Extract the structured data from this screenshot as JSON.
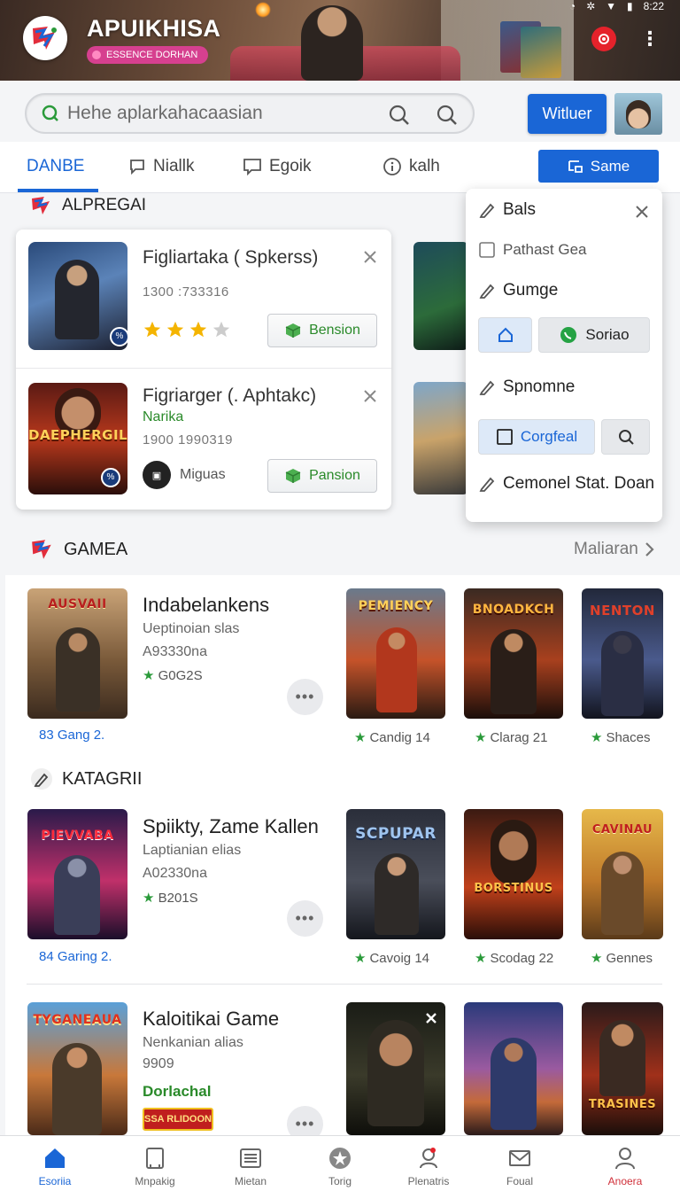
{
  "header": {
    "title": "APUIKHISA",
    "subtitle": "ESSENCE DORHAN",
    "status_time": "8:22",
    "colors": {
      "accent": "#1a66d6",
      "badge": "#d6408f",
      "notif": "#e5222b"
    }
  },
  "search": {
    "placeholder": "Hehe aplarkahacaasian",
    "button_label": "Witluer"
  },
  "tabs": [
    {
      "label": "DANBE",
      "icon": "none"
    },
    {
      "label": "Niallk",
      "icon": "chat-icon"
    },
    {
      "label": "Egoik",
      "icon": "comment-icon"
    },
    {
      "label": "kalh",
      "icon": "info-icon"
    }
  ],
  "tab_action_label": "Same",
  "section1": {
    "title": "ALPREGAI"
  },
  "cards": [
    {
      "title": "Figliartaka ( Spkerss)",
      "number": "1300 :733316",
      "rating": 3,
      "button": "Bension",
      "art_text": "",
      "user": ""
    },
    {
      "title": "Figriarger (. Aphtakc)",
      "tag": "Narika",
      "number": "1900 1990319",
      "button": "Pansion",
      "art_text": "DAEPHERGIL",
      "user": "Miguas"
    }
  ],
  "popup": {
    "title": "Bals",
    "item_checkbox": "Pathast Gea",
    "item2": "Gumge",
    "button_social": "Soriao",
    "item3": "Spnomne",
    "button_check": "Corgfeal",
    "item4": "Cemonel Stat. Doan"
  },
  "section2": {
    "title": "GAMEA",
    "link": "Maliaran"
  },
  "games": [
    {
      "title": "Indabelankens",
      "sub1": "Ueptinoian slas",
      "sub2": "A93330na",
      "rating": "G0G2S",
      "count": "83 Gang  2.",
      "art_text": "AUSVAII",
      "tiles": [
        {
          "art": "PEMIENCY",
          "caption": "Candig   14"
        },
        {
          "art": "BNOADKCH",
          "caption": "Clarag  21"
        },
        {
          "art": "NENTON",
          "caption": "Shaces"
        }
      ]
    },
    {
      "title": "Spiikty, Zame Kallen",
      "sub1": "Laptianian elias",
      "sub2": "A02330na",
      "rating": "B201S",
      "count": "84 Garing  2.",
      "art_text": "PIEVVABA",
      "tiles": [
        {
          "art": "SCPUPAR",
          "caption": "Cavoig   14"
        },
        {
          "art": "BORSTINUS",
          "caption": "Scodag  22"
        },
        {
          "art": "CAVINAU",
          "caption": "Gennes"
        }
      ]
    },
    {
      "title": "Kaloitikai Game",
      "sub1": "Nenkanian alias",
      "sub2": "9909",
      "tag": "Dorlachal",
      "badge": "SSA RLIDOON",
      "art_text": "TYGANEAUA",
      "tiles": [
        {
          "art": "",
          "caption": ""
        },
        {
          "art": "",
          "caption": ""
        },
        {
          "art": "TRASINES",
          "caption": ""
        }
      ]
    }
  ],
  "section3": {
    "title": "KATAGRII"
  },
  "bottom_nav": [
    {
      "label": "Esoriia",
      "icon": "home-icon",
      "active": true
    },
    {
      "label": "Mnpakig",
      "icon": "bookmark-icon"
    },
    {
      "label": "Mietan",
      "icon": "list-icon"
    },
    {
      "label": "Torig",
      "icon": "star-icon"
    },
    {
      "label": "Plenatris",
      "icon": "pin-icon"
    },
    {
      "label": "Foual",
      "icon": "mail-icon"
    },
    {
      "label": "Anoera",
      "icon": "profile-icon"
    }
  ]
}
